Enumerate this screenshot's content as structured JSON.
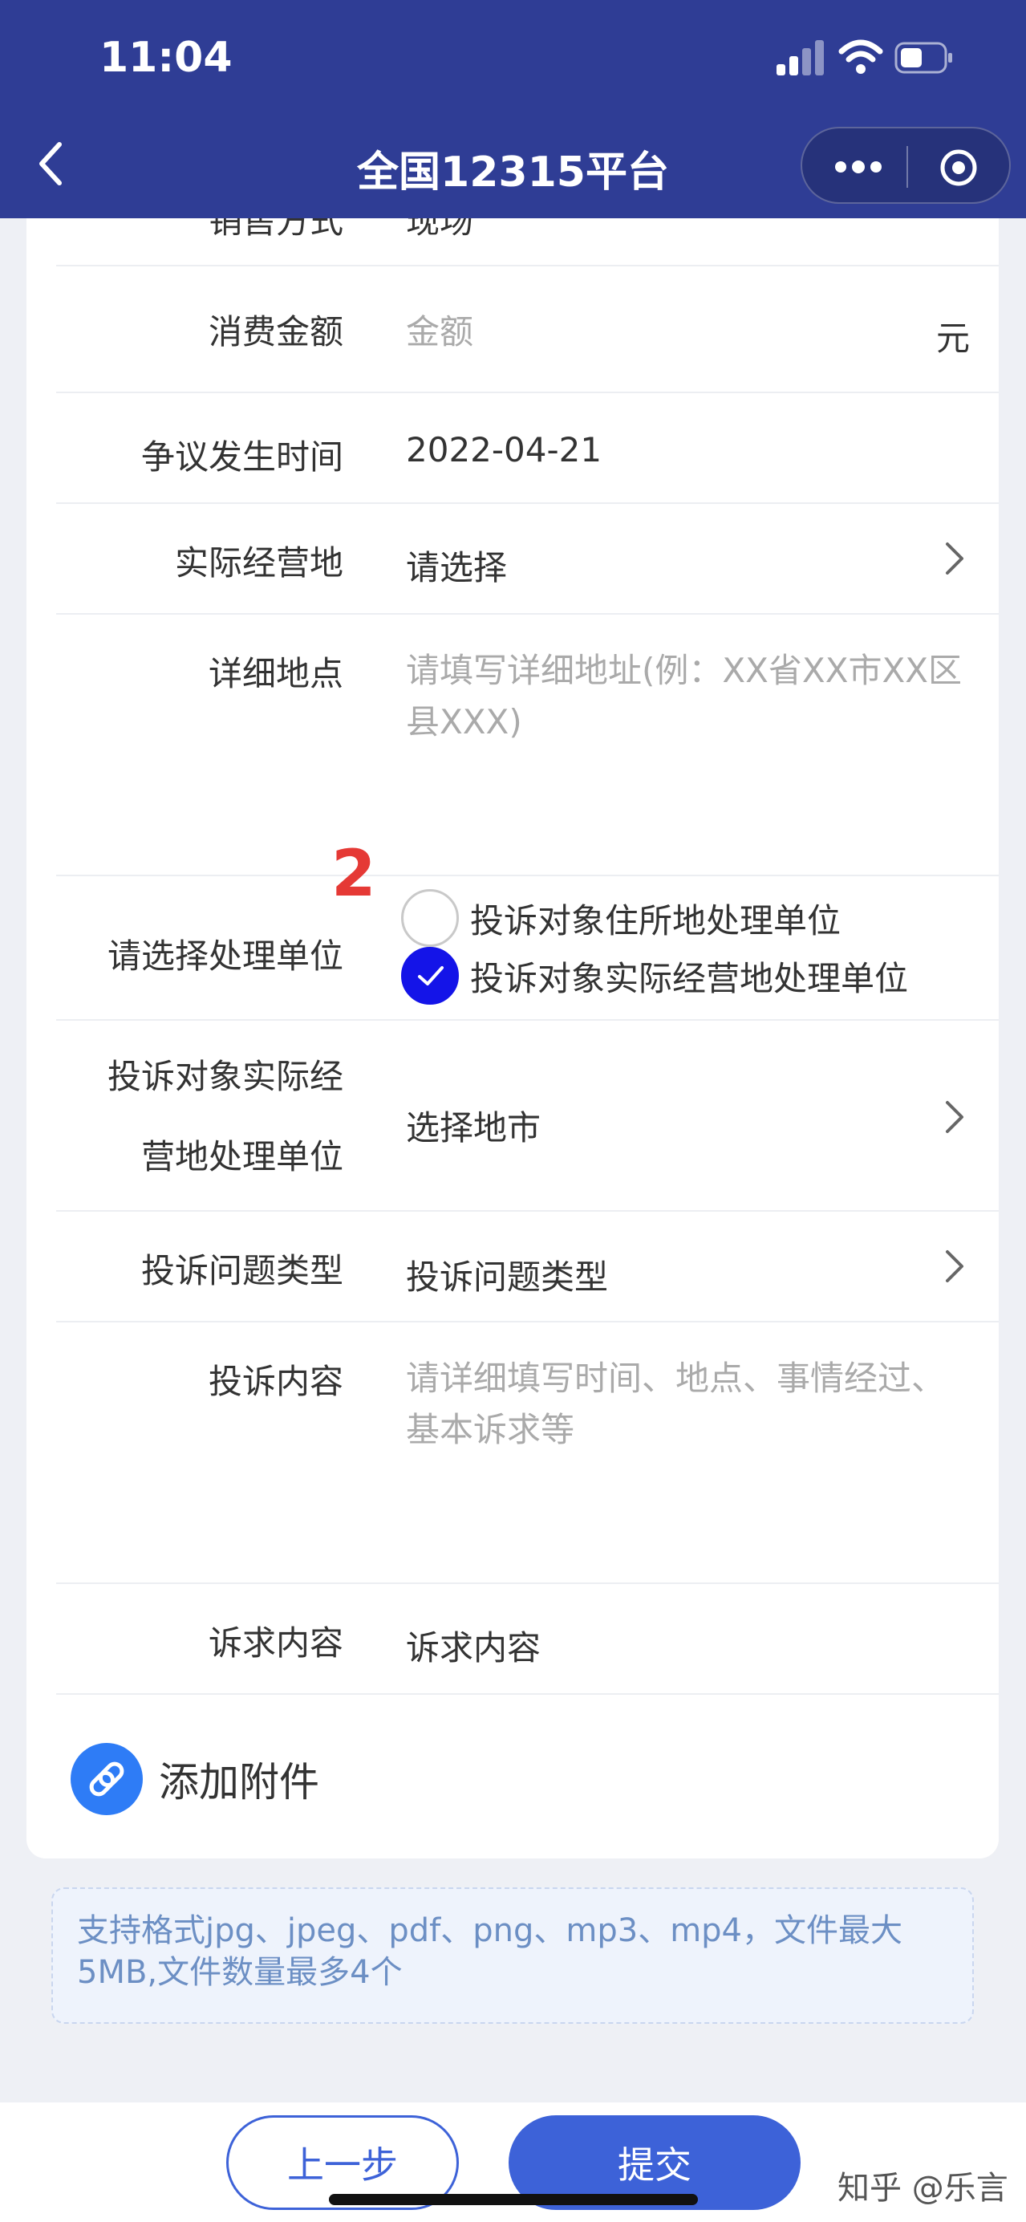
{
  "status_bar": {
    "time": "11:04"
  },
  "header": {
    "title": "全国12315平台"
  },
  "form": {
    "partial_row": {
      "label": "销售方式",
      "value": "现场"
    },
    "amount": {
      "label": "消费金额",
      "placeholder": "金额",
      "unit": "元"
    },
    "dispute_time": {
      "label": "争议发生时间",
      "value": "2022-04-21"
    },
    "actual_location": {
      "label": "实际经营地",
      "value": "请选择"
    },
    "address": {
      "label": "详细地点",
      "placeholder": "请填写详细地址(例：XX省XX市XX区县XXX)"
    },
    "handling_unit": {
      "label": "请选择处理单位",
      "annotation": "2",
      "options": [
        {
          "label": "投诉对象住所地处理单位",
          "checked": false
        },
        {
          "label": "投诉对象实际经营地处理单位",
          "checked": true
        }
      ]
    },
    "actual_unit": {
      "label_line1": "投诉对象实际经",
      "label_line2": "营地处理单位",
      "value": "选择地市"
    },
    "issue_type": {
      "label": "投诉问题类型",
      "value": "投诉问题类型"
    },
    "content": {
      "label": "投诉内容",
      "placeholder": "请详细填写时间、地点、事情经过、基本诉求等"
    },
    "appeal": {
      "label": "诉求内容",
      "value": "诉求内容"
    },
    "attachment": {
      "label": "添加附件"
    }
  },
  "tip": {
    "text": "支持格式jpg、jpeg、pdf、png、mp3、mp4，文件最大5MB,文件数量最多4个"
  },
  "bottom_bar": {
    "prev_label": "上一步",
    "submit_label": "提交",
    "watermark": "知乎 @乐言"
  },
  "colors": {
    "header_bg": "#2f3d95",
    "primary": "#3d62d8",
    "radio_checked": "#1414e8",
    "annotation": "#e53935"
  }
}
